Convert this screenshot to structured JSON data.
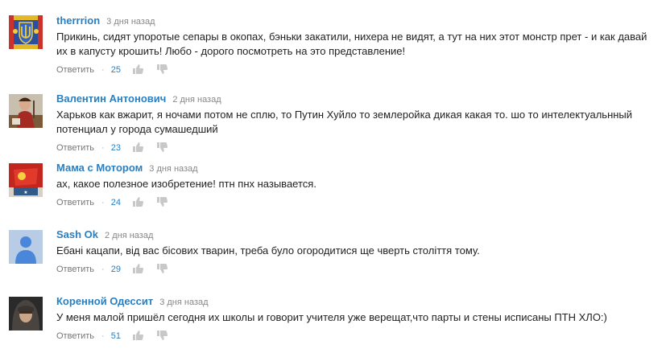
{
  "comments": [
    {
      "author": "therrrion",
      "time": "3 дня назад",
      "text": "Прикинь, сидят упоротые сепары в окопах, бэньки закатили, нихера не видят, а тут на них этот монстр прет - и как давай их в капусту крошить! Любо - дорого посмотреть на это представление!",
      "reply": "Ответить",
      "sep": "·",
      "likes": "25",
      "avatar_icon": "ukraine-coat-of-arms-avatar"
    },
    {
      "author": "Валентин Антонович",
      "time": "2 дня назад",
      "text": "Харьков как вжарит, я ночами потом не сплю, то Путин Хуйло то землеройка дикая какая то. шо то интелектуальнный потенциал у города сумашедший",
      "reply": "Ответить",
      "sep": "·",
      "likes": "23",
      "avatar_icon": "cossack-painting-avatar"
    },
    {
      "author": "Мама с Мотором",
      "time": "3 дня назад",
      "text": "ах, какое полезное изобретение! птн пнх называется.",
      "reply": "Ответить",
      "sep": "·",
      "likes": "24",
      "avatar_icon": "red-flag-avatar"
    },
    {
      "author": "Sash Ok",
      "time": "2 дня назад",
      "text": "Ебані кацапи, від вас бісових тварин, треба було огородитися ще чверть століття тому.",
      "reply": "Ответить",
      "sep": "·",
      "likes": "29",
      "avatar_icon": "default-user-avatar"
    },
    {
      "author": "Коренной Одессит",
      "time": "3 дня назад",
      "text": "У меня малой пришёл сегодня их школы и говорит учителя уже верещат,что парты и стены исписаны ПТН ХЛО:)",
      "reply": "Ответить",
      "sep": "·",
      "likes": "51",
      "avatar_icon": "hooded-man-avatar"
    }
  ],
  "colors": {
    "author": "#2a7fc1",
    "likes": "#2a7fc1",
    "meta": "#888888",
    "text": "#222222",
    "thumb": "#c8c8c8"
  }
}
